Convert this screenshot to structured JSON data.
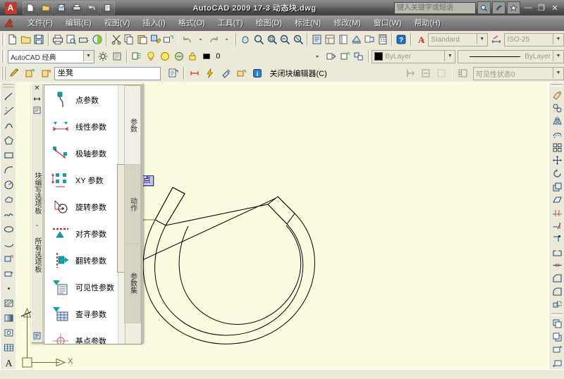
{
  "window": {
    "title": "AutoCAD 2009  17-3 动态块.dwg",
    "app_logo": "A",
    "infocenter_placeholder": "键入关键字或短语",
    "minimize": "—",
    "maximize": "❐",
    "close": "✕",
    "quick_access": [
      {
        "name": "new-file-icon",
        "glyph": "🗋"
      },
      {
        "name": "open-file-icon",
        "glyph": "🗁"
      },
      {
        "name": "save-file-icon",
        "glyph": "💾"
      },
      {
        "name": "plot-icon",
        "glyph": "🖶"
      },
      {
        "name": "undo-icon",
        "glyph": "↩"
      },
      {
        "name": "properties-icon",
        "glyph": "🗒"
      }
    ],
    "infocenter_buttons": [
      {
        "name": "search-icon",
        "glyph": "🔍"
      },
      {
        "name": "signin-icon",
        "glyph": "S"
      },
      {
        "name": "favorites-star-icon",
        "glyph": "★"
      }
    ]
  },
  "menubar": [
    {
      "label": "文件(F)",
      "name": "menu-file"
    },
    {
      "label": "编辑(E)",
      "name": "menu-edit"
    },
    {
      "label": "视图(V)",
      "name": "menu-view"
    },
    {
      "label": "插入(I)",
      "name": "menu-insert"
    },
    {
      "label": "格式(O)",
      "name": "menu-format"
    },
    {
      "label": "工具(T)",
      "name": "menu-tools"
    },
    {
      "label": "绘图(D)",
      "name": "menu-draw"
    },
    {
      "label": "标注(N)",
      "name": "menu-dimension"
    },
    {
      "label": "修改(M)",
      "name": "menu-modify"
    },
    {
      "label": "窗口(W)",
      "name": "menu-window"
    },
    {
      "label": "帮助(H)",
      "name": "menu-help"
    }
  ],
  "standard_toolbar": {
    "text_style_value": "Standard",
    "dim_style_value": "ISO-25"
  },
  "workspace_toolbar": {
    "workspace_value": "AutoCAD 经典",
    "layer_value": "0",
    "color_value": "ByLayer",
    "color_swatch": "#000000",
    "linetype_value": "ByLayer"
  },
  "block_editor_toolbar": {
    "block_name": "坐凳",
    "close_editor_label": "关闭块编辑器(C)",
    "visibility_state_value": "可见性状态0"
  },
  "palette": {
    "vertical_title": "块编写选项板 - 所有选项板",
    "close_glyph": "✕",
    "auto_hide_glyph": "⇤⇥",
    "properties_glyph": "▤",
    "tabs": [
      {
        "label": "参数",
        "name": "palette-tab-parameters",
        "selected": false
      },
      {
        "label": "动作",
        "name": "palette-tab-actions",
        "selected": true
      },
      {
        "label": "参数集",
        "name": "palette-tab-parameter-sets",
        "selected": false
      }
    ],
    "items": [
      {
        "label": "点参数",
        "name": "palette-item-point-parameter",
        "icon": "point-parameter-icon"
      },
      {
        "label": "线性参数",
        "name": "palette-item-linear-parameter",
        "icon": "linear-parameter-icon"
      },
      {
        "label": "极轴参数",
        "name": "palette-item-polar-parameter",
        "icon": "polar-parameter-icon"
      },
      {
        "label": "XY 参数",
        "name": "palette-item-xy-parameter",
        "icon": "xy-parameter-icon"
      },
      {
        "label": "旋转参数",
        "name": "palette-item-rotation-parameter",
        "icon": "rotation-parameter-icon"
      },
      {
        "label": "对齐参数",
        "name": "palette-item-alignment-parameter",
        "icon": "alignment-parameter-icon"
      },
      {
        "label": "翻转参数",
        "name": "palette-item-flip-parameter",
        "icon": "flip-parameter-icon"
      },
      {
        "label": "可见性参数",
        "name": "palette-item-visibility-parameter",
        "icon": "visibility-parameter-icon"
      },
      {
        "label": "查寻参数",
        "name": "palette-item-lookup-parameter",
        "icon": "lookup-parameter-icon"
      },
      {
        "label": "基点参数",
        "name": "palette-item-basepoint-parameter",
        "icon": "basepoint-parameter-icon"
      }
    ]
  },
  "drawing": {
    "snap_tooltip": "中点",
    "ucs_x_label": "X",
    "ucs_y_label": "Y",
    "background_color": "#fbfbe0",
    "geometry_color": "#000000",
    "cursor_color": "#7a7a4a"
  }
}
